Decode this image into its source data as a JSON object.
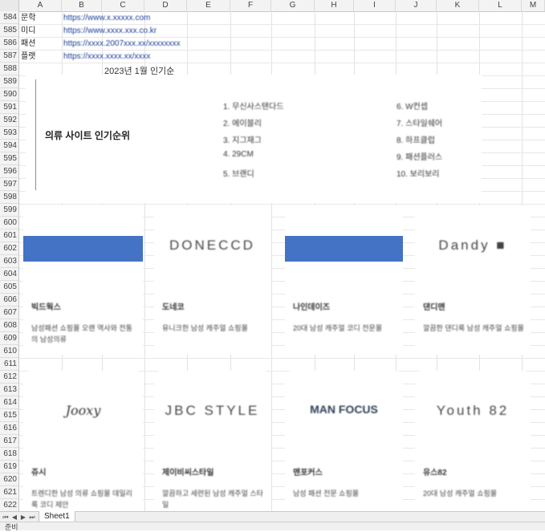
{
  "columns": [
    "A",
    "B",
    "C",
    "D",
    "E",
    "F",
    "G",
    "H",
    "I",
    "J",
    "K",
    "L",
    "M"
  ],
  "rows": [
    "584",
    "585",
    "586",
    "587",
    "588",
    "589",
    "590",
    "591",
    "592",
    "593",
    "594",
    "595",
    "596",
    "597",
    "598",
    "599",
    "600",
    "601",
    "602",
    "603",
    "604",
    "605",
    "606",
    "607",
    "608",
    "609",
    "610",
    "611",
    "612",
    "613",
    "614",
    "615",
    "616",
    "617",
    "618",
    "619",
    "620",
    "621",
    "622"
  ],
  "top_rows": [
    {
      "label": "문학",
      "link": "https://www.x.xxxxx.com"
    },
    {
      "label": "미디",
      "link": "https://www.xxxx.xxx.co.kr"
    },
    {
      "label": "패션",
      "link": "https://xxxx.2007xxx.xx/xxxxxxxx"
    },
    {
      "label": "플랫",
      "link": "https://xxxx.xxxx.xx/xxxx"
    }
  ],
  "month_title": "2023년 1월 인기순",
  "ranking": {
    "title": "의류 사이트 인기순위",
    "left": [
      "1. 무신사스탠다드",
      "2. 에이블리",
      "3. 지그재그",
      "4. 29CM",
      "5. 브랜디"
    ],
    "right": [
      "6. W컨셉",
      "7. 스타일쉐어",
      "8. 하프클럽",
      "9. 패션플러스",
      "10. 보리보리"
    ]
  },
  "cards": [
    {
      "logo_type": "blue",
      "logo_text": "",
      "name": "빅드웍스",
      "desc": "남성패션 쇼핑몰 오랜 역사와 전통의 남성의류"
    },
    {
      "logo_type": "text",
      "logo_text": "DONECCD",
      "name": "도네코",
      "desc": "유니크한 남성 캐주얼 쇼핑몰"
    },
    {
      "logo_type": "blue",
      "logo_text": "",
      "name": "나인데이즈",
      "desc": "20대 남성 캐주얼 코디 전문몰"
    },
    {
      "logo_type": "text",
      "logo_text": "Dandy ■",
      "name": "댄디맨",
      "desc": "깔끔한 댄디룩 남성 캐주얼 쇼핑몰"
    },
    {
      "logo_type": "script",
      "logo_text": "Jooxy",
      "name": "쥬시",
      "desc": "트렌디한 남성 의류 쇼핑몰 데일리룩 코디 제안"
    },
    {
      "logo_type": "text",
      "logo_text": "JBC STYLE",
      "name": "제이비씨스타일",
      "desc": "깔끔하고 세련된 남성 캐주얼 스타일"
    },
    {
      "logo_type": "bold",
      "logo_text": "MAN FOCUS",
      "name": "맨포커스",
      "desc": "남성 패션 전문 쇼핑몰"
    },
    {
      "logo_type": "text",
      "logo_text": "Youth 82",
      "name": "유스82",
      "desc": "20대 남성 캐주얼 쇼핑몰"
    }
  ],
  "sheet_tab": "Sheet1",
  "status": "준비",
  "colors": {
    "logo_blue": "#4472c4",
    "header_bg": "#f3f3f3",
    "grid": "#e2e2e2"
  }
}
